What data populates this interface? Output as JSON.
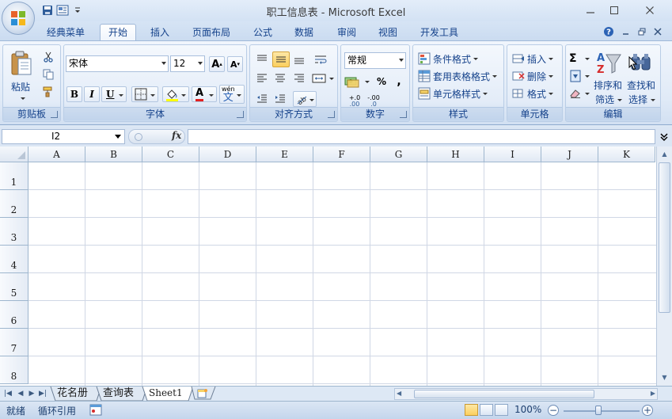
{
  "window": {
    "title": "职工信息表 - Microsoft Excel",
    "controls": [
      "—",
      "☐",
      "✕"
    ]
  },
  "ribbon_tabs": [
    {
      "label": "经典菜单",
      "active": false
    },
    {
      "label": "开始",
      "active": true
    },
    {
      "label": "插入",
      "active": false
    },
    {
      "label": "页面布局",
      "active": false
    },
    {
      "label": "公式",
      "active": false
    },
    {
      "label": "数据",
      "active": false
    },
    {
      "label": "审阅",
      "active": false
    },
    {
      "label": "视图",
      "active": false
    },
    {
      "label": "开发工具",
      "active": false
    }
  ],
  "ribbon": {
    "clipboard": {
      "label": "剪贴板",
      "paste": "粘贴"
    },
    "font": {
      "label": "字体",
      "name": "宋体",
      "size": "12",
      "bold": "B",
      "italic": "I",
      "underline": "U",
      "font_color": "A",
      "phonetic": "wén"
    },
    "alignment": {
      "label": "对齐方式"
    },
    "number": {
      "label": "数字",
      "format": "常规",
      "percent": "%",
      "comma": ",",
      "inc_decimal": "+.0",
      "dec_decimal": "-.00"
    },
    "styles": {
      "label": "样式",
      "conditional": "条件格式",
      "table_format": "套用表格格式",
      "cell_styles": "单元格样式"
    },
    "cells": {
      "label": "单元格",
      "insert": "插入",
      "delete": "删除",
      "format": "格式"
    },
    "editing": {
      "label": "编辑",
      "sigma": "Σ",
      "sort_line1": "排序和",
      "sort_line2": "筛选",
      "find_line1": "查找和",
      "find_line2": "选择"
    }
  },
  "formula_bar": {
    "name_box": "I2",
    "fx": "fx",
    "formula": ""
  },
  "columns": [
    "A",
    "B",
    "C",
    "D",
    "E",
    "F",
    "G",
    "H",
    "I",
    "J",
    "K"
  ],
  "rows": [
    "1",
    "2",
    "3",
    "4",
    "5",
    "6",
    "7",
    "8"
  ],
  "sheets": [
    {
      "label": "花名册",
      "active": false
    },
    {
      "label": "查询表",
      "active": false
    },
    {
      "label": "Sheet1",
      "active": true
    }
  ],
  "status": {
    "ready": "就绪",
    "circular": "循环引用",
    "zoom": "100%"
  },
  "colors": {
    "ribbon_text": "#15428b",
    "selected_button": "#fbcf5e",
    "gridline": "#d0d7e5"
  }
}
